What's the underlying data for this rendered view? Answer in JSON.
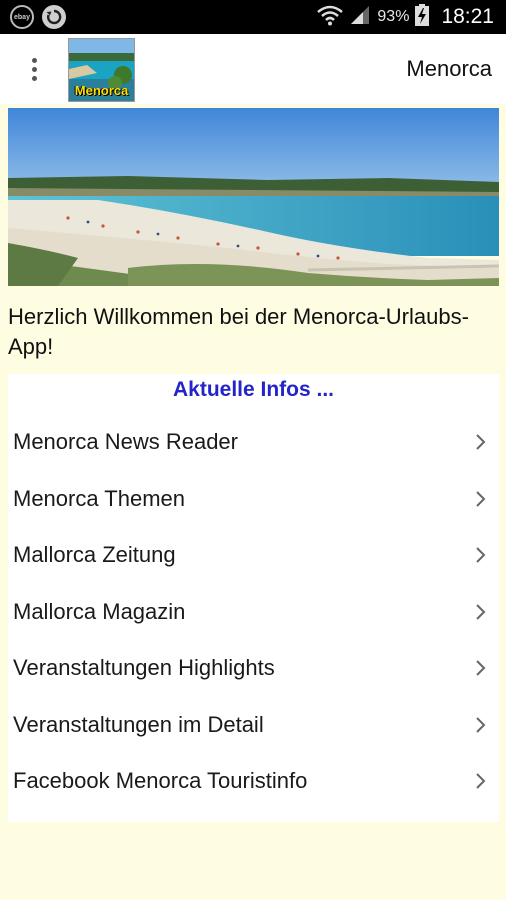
{
  "status_bar": {
    "ebay_icon_label": "ebay Kleinanzeigen",
    "battery_percent": "93%",
    "time": "18:21"
  },
  "app_bar": {
    "title": "Menorca",
    "logo_text": "Menorca"
  },
  "welcome_text": "Herzlich Willkommen bei der Menorca-Urlaubs-App!",
  "info_section": {
    "heading": "Aktuelle Infos ...",
    "items": [
      {
        "label": "Menorca News Reader"
      },
      {
        "label": "Menorca Themen"
      },
      {
        "label": "Mallorca Zeitung"
      },
      {
        "label": "Mallorca Magazin"
      },
      {
        "label": "Veranstaltungen Highlights"
      },
      {
        "label": "Veranstaltungen im Detail"
      },
      {
        "label": "Facebook Menorca Touristinfo"
      }
    ]
  },
  "colors": {
    "background": "#fefde2",
    "heading": "#2424c8",
    "status_bar": "#000000"
  },
  "icons": [
    "menu-overflow-icon",
    "wifi-icon",
    "signal-icon",
    "battery-charging-icon",
    "sync-icon",
    "chevron-right-icon"
  ]
}
